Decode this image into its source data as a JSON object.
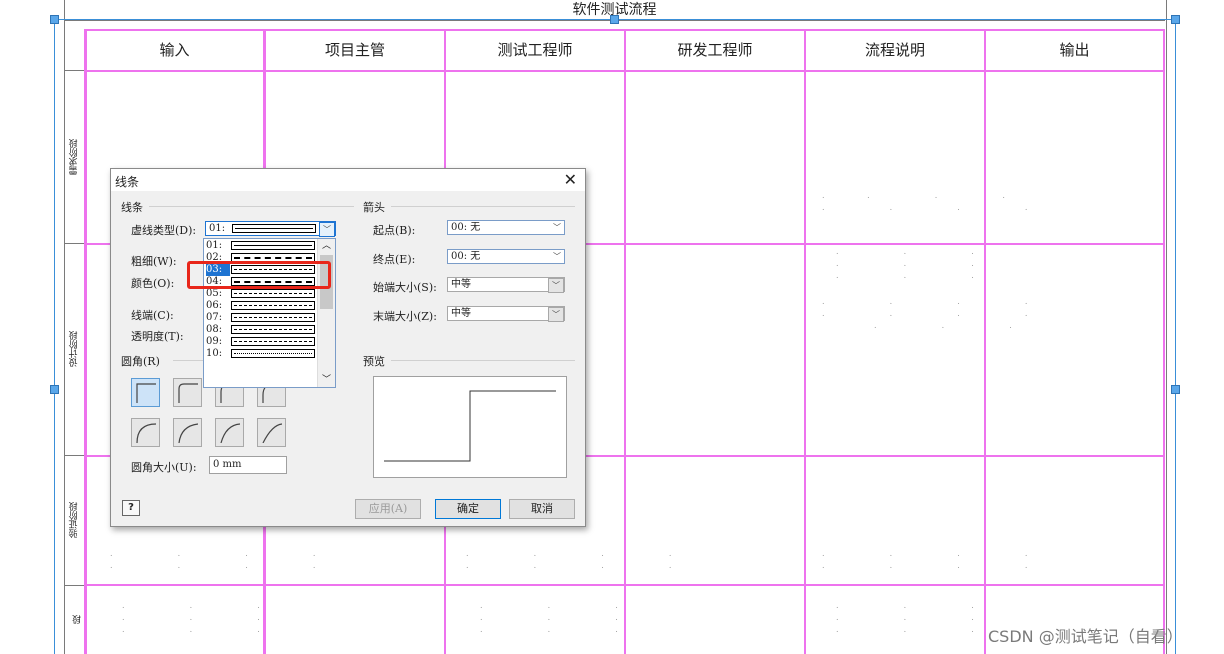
{
  "diagram": {
    "title": "软件测试流程",
    "columns": [
      "输入",
      "项目主管",
      "测试工程师",
      "研发工程师",
      "流程说明",
      "输出"
    ],
    "lanes": [
      "需求阶段",
      "设计阶段",
      "验证阶段",
      "段"
    ],
    "accent_color": "#ee73ee",
    "selection_color": "#3a8fd8"
  },
  "dialog": {
    "title": "线条",
    "close_icon": "close-icon",
    "line_group": {
      "label": "线条",
      "dash_type_label": "虚线类型(D):",
      "dash_type_value": "01:",
      "weight_label": "粗细(W):",
      "color_label": "颜色(O):",
      "cap_label": "线端(C):",
      "transparency_label": "透明度(T):",
      "dash_options": [
        {
          "num": "01:",
          "style": "solid"
        },
        {
          "num": "02:",
          "style": "long-dash"
        },
        {
          "num": "03:",
          "style": "dotted"
        },
        {
          "num": "04:",
          "style": "dash"
        },
        {
          "num": "05:",
          "style": "dash-dot"
        },
        {
          "num": "06:",
          "style": "long-dash-dot"
        },
        {
          "num": "07:",
          "style": "dash-small"
        },
        {
          "num": "08:",
          "style": "long-short"
        },
        {
          "num": "09:",
          "style": "short-dash"
        },
        {
          "num": "10:",
          "style": "fine-dot"
        }
      ],
      "selected_option": "03:"
    },
    "arrow_group": {
      "label": "箭头",
      "start_label": "起点(B):",
      "start_value": "00: 无",
      "end_label": "终点(E):",
      "end_value": "00: 无",
      "start_size_label": "始端大小(S):",
      "start_size_value": "中等",
      "end_size_label": "末端大小(Z):",
      "end_size_value": "中等"
    },
    "corner_group": {
      "label": "圆角(R)",
      "radius_label": "圆角大小(U):",
      "radius_value": "0 mm"
    },
    "preview_group": {
      "label": "预览"
    },
    "buttons": {
      "help": "?",
      "apply": "应用(A)",
      "ok": "确定",
      "cancel": "取消"
    }
  },
  "watermark": "CSDN @测试笔记（自看）"
}
